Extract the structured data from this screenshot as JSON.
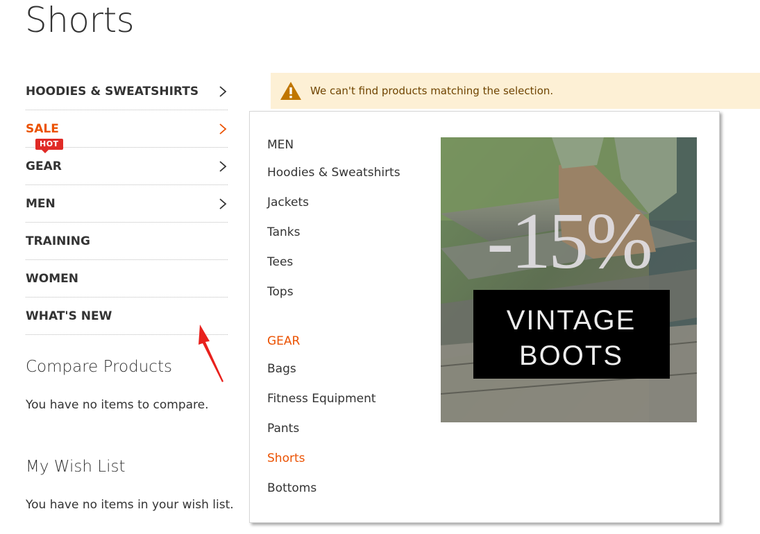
{
  "page": {
    "title": "Shorts"
  },
  "sidebar": {
    "items": [
      {
        "label": "HOODIES & SWEATSHIRTS",
        "chevron": true,
        "active": false,
        "badge": ""
      },
      {
        "label": "SALE",
        "chevron": true,
        "active": true,
        "badge": ""
      },
      {
        "label": "GEAR",
        "chevron": true,
        "active": false,
        "badge": "HOT"
      },
      {
        "label": "MEN",
        "chevron": true,
        "active": false,
        "badge": ""
      },
      {
        "label": "TRAINING",
        "chevron": false,
        "active": false,
        "badge": ""
      },
      {
        "label": "WOMEN",
        "chevron": false,
        "active": false,
        "badge": ""
      },
      {
        "label": "WHAT'S NEW",
        "chevron": false,
        "active": false,
        "badge": ""
      }
    ]
  },
  "compare": {
    "title": "Compare Products",
    "empty_text": "You have no items to compare."
  },
  "wishlist": {
    "title": "My Wish List",
    "empty_text": "You have no items in your wish list."
  },
  "notice": {
    "text": "We can't find products matching the selection.",
    "icon": "warning-icon"
  },
  "dropdown": {
    "groups": [
      {
        "heading": "MEN",
        "heading_accent": false,
        "links": [
          "Hoodies & Sweatshirts",
          "Jackets",
          "Tanks",
          "Tees",
          "Tops"
        ]
      },
      {
        "heading": "GEAR",
        "heading_accent": true,
        "links": [
          "Bags",
          "Fitness Equipment",
          "Pants",
          "Shorts",
          "Bottoms"
        ]
      }
    ],
    "active_link": "Shorts",
    "promo": {
      "discount": "-15%",
      "line1": "VINTAGE",
      "line2": "BOOTS"
    }
  },
  "colors": {
    "accent": "#eb5202",
    "badge": "#e02b27",
    "notice_bg": "#fdf0d5",
    "notice_text": "#6f4400",
    "warning_icon": "#c07600",
    "annotation_arrow": "#e8211d"
  }
}
